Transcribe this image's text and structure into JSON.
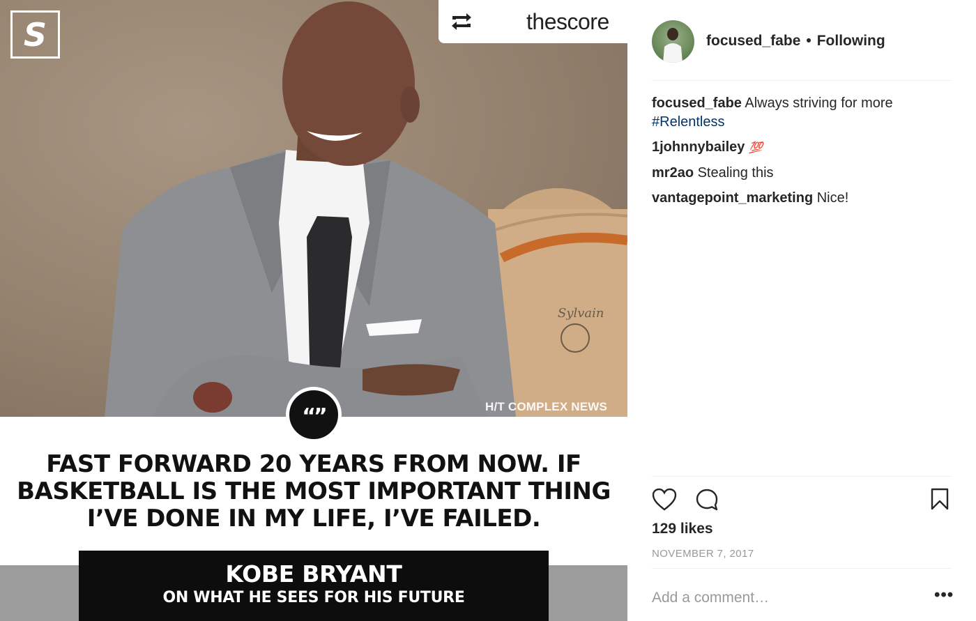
{
  "post_image": {
    "brand_logo": "S",
    "repost_label": "thescore",
    "credit": "H/T COMPLEX NEWS",
    "quote_mark": "“”",
    "quote": "FAST FORWARD 20 YEARS FROM NOW. IF BASKETBALL IS THE MOST IMPORTANT THING I’VE DONE IN MY LIFE, I’VE FAILED.",
    "name": "KOBE BRYANT",
    "subtitle": "ON WHAT HE SEES FOR HIS FUTURE"
  },
  "header": {
    "username": "focused_fabe",
    "separator": "•",
    "follow_status": "Following"
  },
  "comments": [
    {
      "user": "focused_fabe",
      "text": "Always striving for more",
      "hashtag": "#Relentless"
    },
    {
      "user": "1johnnybailey",
      "emoji": "💯"
    },
    {
      "user": "mr2ao",
      "text": "Stealing this"
    },
    {
      "user": "vantagepoint_marketing",
      "text": "Nice!"
    }
  ],
  "engagement": {
    "likes": "129 likes",
    "date": "NOVEMBER 7, 2017"
  },
  "comment_box": {
    "placeholder": "Add a comment…",
    "more_label": "•••"
  },
  "colors": {
    "hashtag": "#003569",
    "muted": "#999999",
    "text": "#262626"
  },
  "icons": [
    "repost-icon",
    "heart-icon",
    "comment-icon",
    "bookmark-icon",
    "more-options-icon"
  ]
}
